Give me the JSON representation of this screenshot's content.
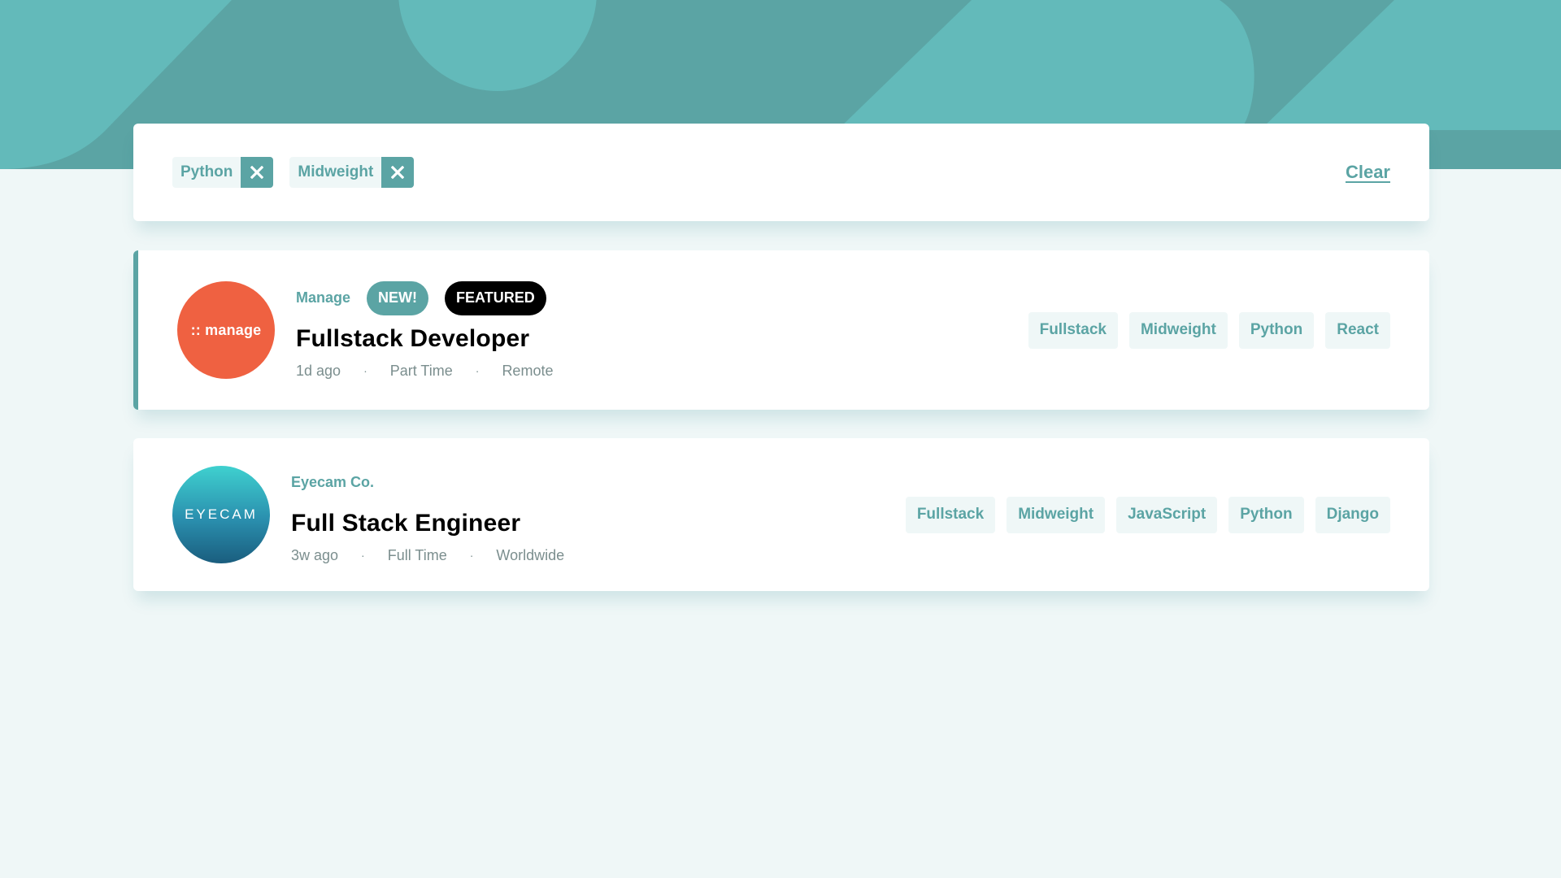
{
  "colors": {
    "primary": "#5ba4a4",
    "background": "#eff7f7",
    "featured_badge": "#000000",
    "manage_logo": "#ef6141",
    "text_muted": "#7b8e8e"
  },
  "filter_bar": {
    "filters": [
      {
        "label": "Python",
        "remove_icon": "close-icon"
      },
      {
        "label": "Midweight",
        "remove_icon": "close-icon"
      }
    ],
    "clear_label": "Clear"
  },
  "jobs": [
    {
      "logo_text": ":: manage",
      "company": "Manage",
      "new_badge": "NEW!",
      "featured_badge": "FEATURED",
      "position": "Fullstack Developer",
      "posted": "1d ago",
      "contract": "Part Time",
      "location": "Remote",
      "dot": "·",
      "tags": [
        "Fullstack",
        "Midweight",
        "Python",
        "React"
      ]
    },
    {
      "logo_text": "EYECAM",
      "company": "Eyecam Co.",
      "position": "Full Stack Engineer",
      "posted": "3w ago",
      "contract": "Full Time",
      "location": "Worldwide",
      "dot": "·",
      "tags": [
        "Fullstack",
        "Midweight",
        "JavaScript",
        "Python",
        "Django"
      ]
    }
  ]
}
